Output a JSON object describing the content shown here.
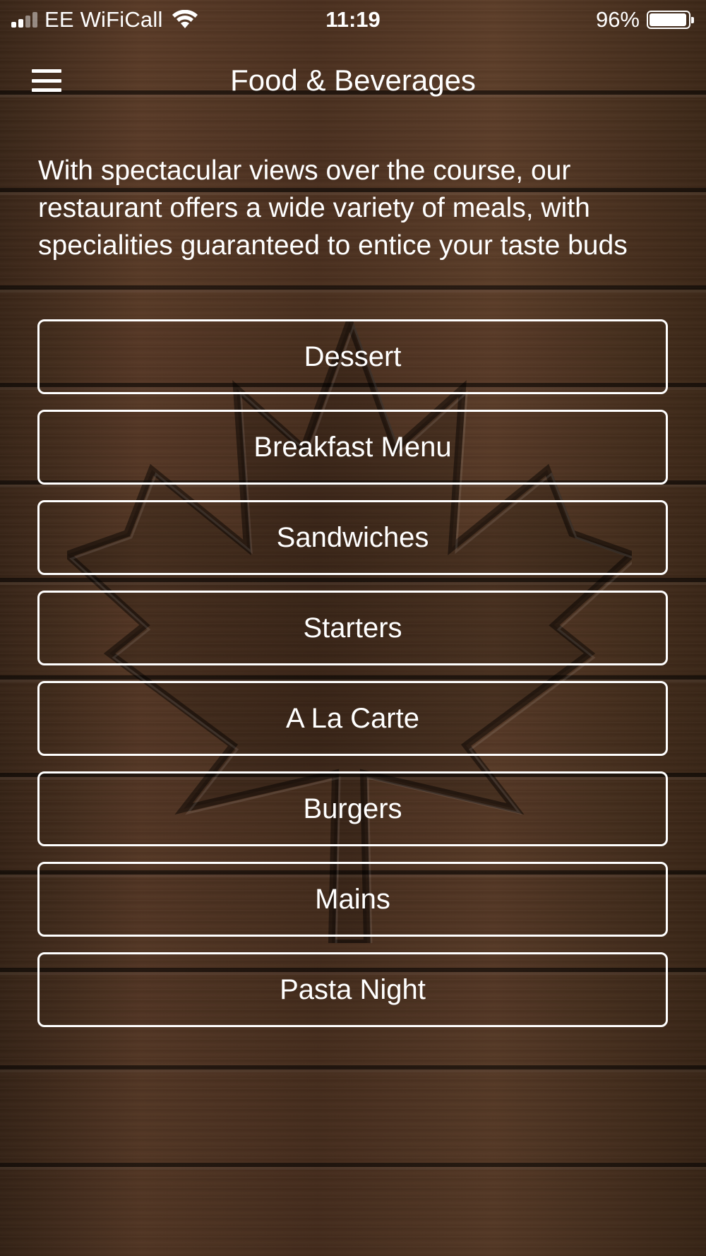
{
  "status_bar": {
    "carrier": "EE WiFiCall",
    "time": "11:19",
    "battery_percent": "96%",
    "battery_level": 0.96,
    "signal_bars": 2,
    "signal_bars_total": 4,
    "signal_icon": "cellular-signal-icon",
    "wifi_icon": "wifi-icon",
    "battery_icon": "battery-icon"
  },
  "nav": {
    "menu_icon": "hamburger-icon",
    "title": "Food & Beverages"
  },
  "intro": {
    "text": "With spectacular views over the course, our restaurant offers a wide variety of meals, with specialities guaranteed to entice your taste buds"
  },
  "menu_items": [
    {
      "label": "Dessert"
    },
    {
      "label": "Breakfast Menu"
    },
    {
      "label": "Sandwiches"
    },
    {
      "label": "Starters"
    },
    {
      "label": "A La Carte"
    },
    {
      "label": "Burgers"
    },
    {
      "label": "Mains"
    },
    {
      "label": "Pasta Night"
    }
  ],
  "background": {
    "icon": "maple-leaf-icon",
    "wood_color": "#4a3222",
    "border_color": "#ffffff"
  }
}
